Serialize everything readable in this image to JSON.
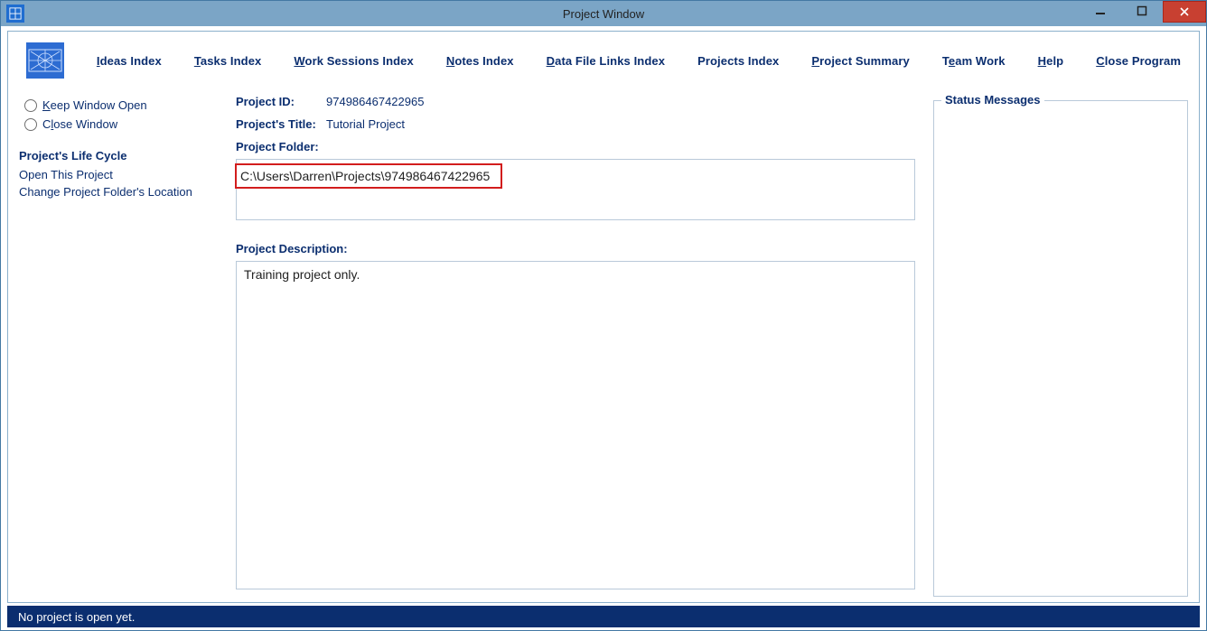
{
  "window": {
    "title": "Project Window"
  },
  "menu": {
    "items": [
      {
        "pre": "",
        "u": "I",
        "post": "deas Index"
      },
      {
        "pre": "",
        "u": "T",
        "post": "asks Index"
      },
      {
        "pre": "",
        "u": "W",
        "post": "ork Sessions Index"
      },
      {
        "pre": "",
        "u": "N",
        "post": "otes Index"
      },
      {
        "pre": "",
        "u": "D",
        "post": "ata File Links Index"
      },
      {
        "pre": "Pro",
        "u": "j",
        "post": "ects Index"
      },
      {
        "pre": "",
        "u": "P",
        "post": "roject Summary"
      },
      {
        "pre": "T",
        "u": "e",
        "post": "am Work"
      },
      {
        "pre": "",
        "u": "H",
        "post": "elp"
      },
      {
        "pre": "",
        "u": "C",
        "post": "lose Program"
      }
    ]
  },
  "sidebar": {
    "radios": [
      {
        "pre": "",
        "u": "K",
        "post": "eep Window Open"
      },
      {
        "pre": "C",
        "u": "l",
        "post": "ose Window"
      }
    ],
    "heading": "Project's Life Cycle",
    "links": [
      "Open This Project",
      "Change Project Folder's Location"
    ]
  },
  "form": {
    "project_id_label": "Project ID:",
    "project_id_value": "974986467422965",
    "project_title_label": "Project's Title:",
    "project_title_value": "Tutorial Project",
    "project_folder_label": "Project Folder:",
    "project_folder_value": "C:\\Users\\Darren\\Projects\\974986467422965",
    "desc_label": "Project Description:",
    "desc_value": "Training project only."
  },
  "right": {
    "legend": "Status Messages"
  },
  "status": {
    "text": "No project is open yet."
  }
}
